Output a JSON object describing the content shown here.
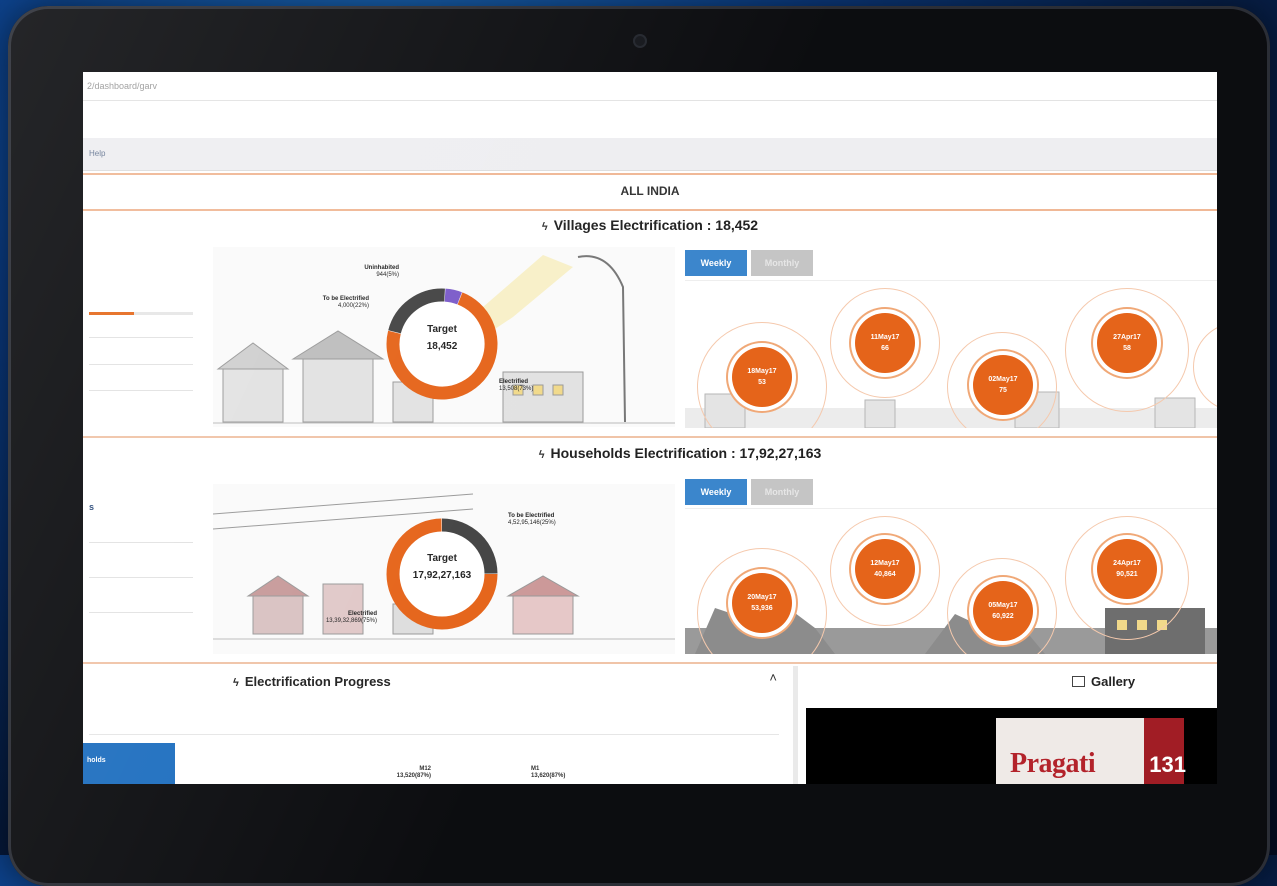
{
  "browser": {
    "url": "2/dashboard/garv"
  },
  "menu": {
    "help_label": "Help"
  },
  "region": {
    "title": "ALL INDIA"
  },
  "villages": {
    "title": "Villages Electrification : 18,452",
    "donut": {
      "center_label": "Target",
      "center_value": "18,452",
      "segments": [
        {
          "name": "Electrified",
          "label": "Electrified",
          "value_text": "13,508(73%)",
          "fraction": 0.73,
          "color": "#e5641a"
        },
        {
          "name": "To be Electrified",
          "label": "To be Electrified",
          "value_text": "4,000(22%)",
          "fraction": 0.22,
          "color": "#444444"
        },
        {
          "name": "Uninhabited",
          "label": "Uninhabited",
          "value_text": "944(5%)",
          "fraction": 0.05,
          "color": "#7b5bc9"
        }
      ]
    },
    "tabs": {
      "weekly": "Weekly",
      "monthly": "Monthly"
    },
    "bubbles": [
      {
        "date": "18May17",
        "value": "53"
      },
      {
        "date": "11May17",
        "value": "66"
      },
      {
        "date": "02May17",
        "value": "75"
      },
      {
        "date": "27Apr17",
        "value": "58"
      }
    ]
  },
  "households": {
    "title": "Households Electrification : 17,92,27,163",
    "donut": {
      "center_label": "Target",
      "center_value": "17,92,27,163",
      "segments": [
        {
          "name": "Electrified",
          "label": "Electrified",
          "value_text": "13,39,32,869(75%)",
          "fraction": 0.75,
          "color": "#e5641a"
        },
        {
          "name": "To be Electrified",
          "label": "To be Electrified",
          "value_text": "4,52,95,146(25%)",
          "fraction": 0.25,
          "color": "#444444"
        }
      ]
    },
    "tabs": {
      "weekly": "Weekly",
      "monthly": "Monthly"
    },
    "bubbles": [
      {
        "date": "20May17",
        "value": "53,936"
      },
      {
        "date": "12May17",
        "value": "40,864"
      },
      {
        "date": "05May17",
        "value": "60,922"
      },
      {
        "date": "24Apr17",
        "value": "90,521"
      }
    ],
    "side_label": "s"
  },
  "progress": {
    "title": "Electrification Progress",
    "tab_label": "holds",
    "markers": [
      {
        "name": "M12",
        "value": "13,520(87%)"
      },
      {
        "name": "M1",
        "value": "13,620(87%)"
      }
    ]
  },
  "gallery": {
    "title": "Gallery",
    "thumb_word": "Pragati",
    "thumb_number": "131"
  },
  "colors": {
    "accent_orange": "#e5641a",
    "tab_blue": "#3b86cc",
    "tab_grey": "#c5c5c5",
    "section_border": "#f0c4a8"
  },
  "icons": {
    "section_bolt": "lightning-bolt-icon",
    "collapse": "chevron-up-icon",
    "gallery": "image-icon"
  }
}
